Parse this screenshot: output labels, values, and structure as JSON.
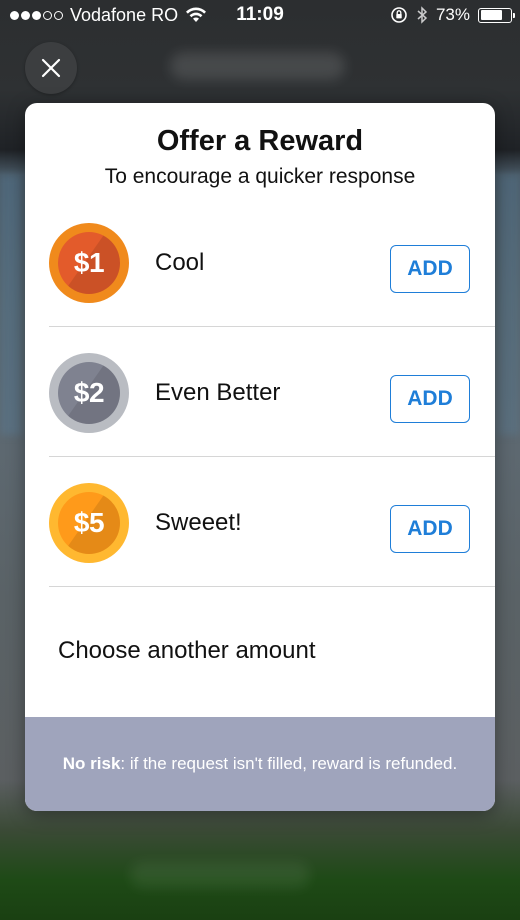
{
  "status_bar": {
    "carrier": "Vodafone RO",
    "time": "11:09",
    "battery": "73%",
    "battery_level": 0.73
  },
  "modal": {
    "title": "Offer a Reward",
    "subtitle": "To encourage a quicker response",
    "rewards": [
      {
        "amount": "$1",
        "label": "Cool",
        "button": "ADD"
      },
      {
        "amount": "$2",
        "label": "Even Better",
        "button": "ADD"
      },
      {
        "amount": "$5",
        "label": "Sweeet!",
        "button": "ADD"
      }
    ],
    "another_amount": "Choose another amount",
    "footer": {
      "bold": "No risk",
      "text": ": if the request isn't filled, reward is refunded."
    }
  },
  "colors": {
    "accent": "#1f7ed8",
    "footer_bg": "#9fa4bc",
    "coin_1": "#e35b2b",
    "coin_2": "#7f8290",
    "coin_5": "#ff9a1a"
  },
  "icons": {
    "close": "close-icon",
    "wifi": "wifi-icon",
    "orientation_lock": "orientation-lock-icon",
    "bluetooth": "bluetooth-icon",
    "battery": "battery-icon"
  }
}
